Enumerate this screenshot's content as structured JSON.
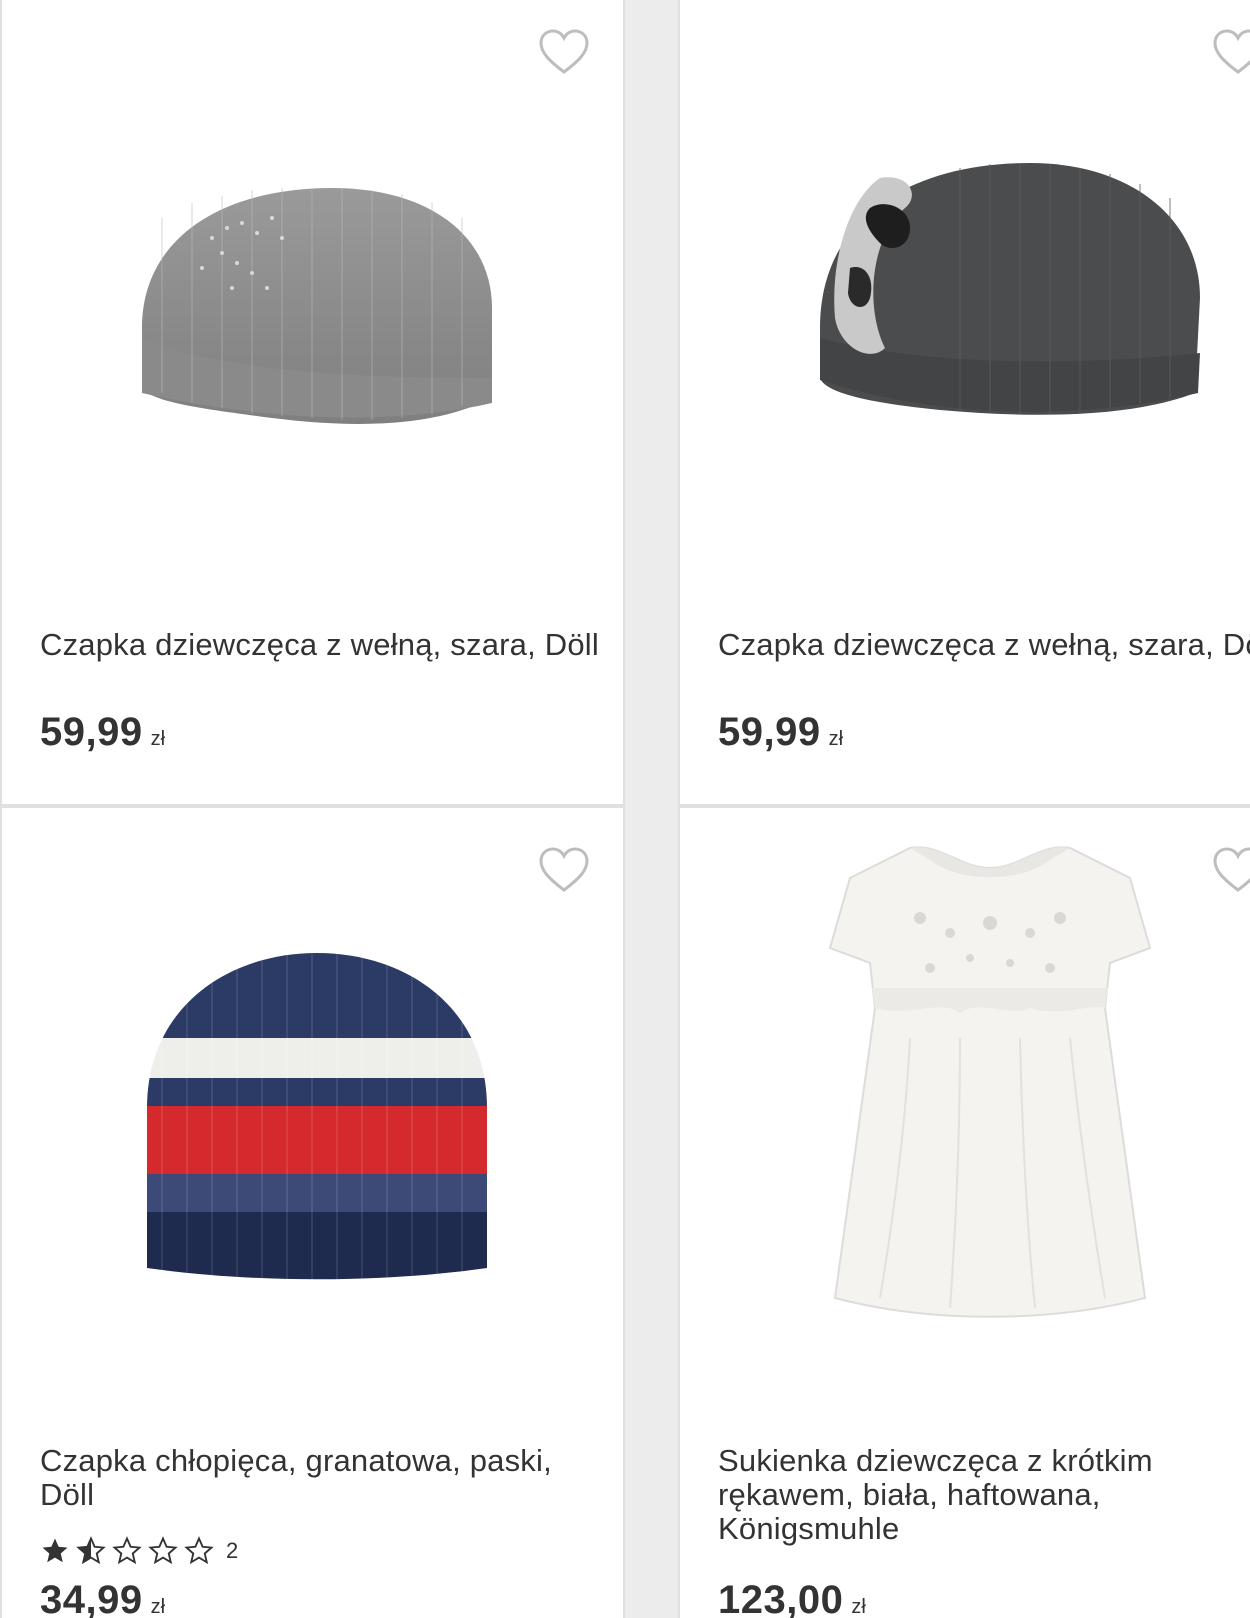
{
  "products": [
    {
      "title": "Czapka dziewczęca z wełną, szara, Döll",
      "price": "59,99",
      "currency": "zł",
      "image": "grey-knit-beret",
      "wishlist_icon": "heart-outline-icon"
    },
    {
      "title": "Czapka dziewczęca z wełną, szara, Döll",
      "price": "59,99",
      "currency": "zł",
      "image": "dark-grey-beret-with-sequins",
      "wishlist_icon": "heart-outline-icon"
    },
    {
      "title": "Czapka chłopięca, granatowa, paski, Döll",
      "rating": 1.5,
      "rating_max": 5,
      "review_count": "2",
      "price": "34,99",
      "currency": "zł",
      "image": "navy-striped-beanie",
      "wishlist_icon": "heart-outline-icon"
    },
    {
      "title": "Sukienka dziewczęca z krótkim rękawem, biała, haftowana, Königsmuhle",
      "price": "123,00",
      "currency": "zł",
      "image": "white-embroidered-dress",
      "wishlist_icon": "heart-outline-icon"
    }
  ],
  "colors": {
    "text": "#333333",
    "card_border": "#e0e0e0",
    "heart": "#bdbdbd"
  }
}
